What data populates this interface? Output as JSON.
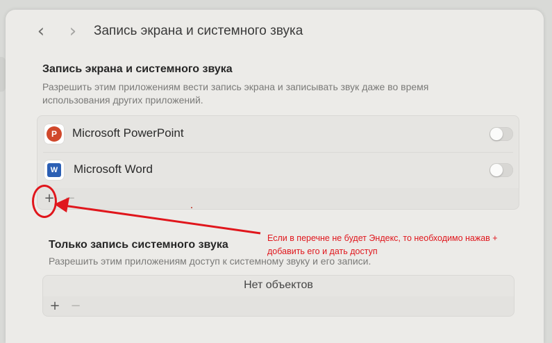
{
  "window": {
    "title": "Запись экрана и системного звука",
    "back_icon": "‹",
    "forward_icon": "›"
  },
  "screen_audio": {
    "title": "Запись экрана и системного звука",
    "description": "Разрешить этим приложениям вести запись экрана и записывать звук даже во время использования других приложений.",
    "apps": [
      {
        "name": "Microsoft PowerPoint",
        "icon": "powerpoint-icon",
        "icon_letter": "P",
        "icon_color": "#d0482b",
        "enabled": false
      },
      {
        "name": "Microsoft Word",
        "icon": "word-icon",
        "icon_letter": "W",
        "icon_color": "#2b5fb4",
        "enabled": false
      }
    ],
    "add_label": "+",
    "remove_label": "−"
  },
  "audio_only": {
    "title": "Только запись системного звука",
    "description": "Разрешить этим приложениям доступ к системному звуку и его записи.",
    "empty_text": "Нет объектов",
    "add_label": "+",
    "remove_label": "−"
  },
  "annotation": {
    "text": "Если в перечне не будет Эндекс, то необходимо нажав + добавить его и дать доступ",
    "color": "#e0161c"
  }
}
